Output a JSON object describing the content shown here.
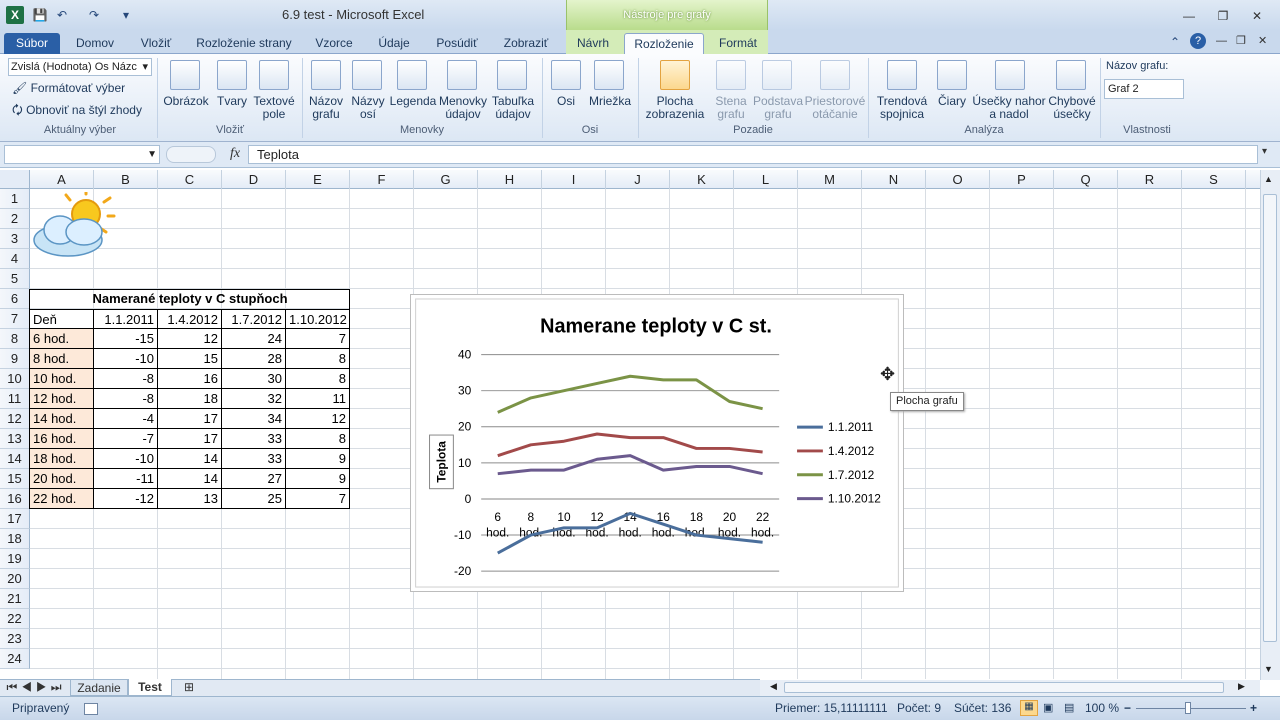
{
  "window": {
    "title": "6.9 test  -  Microsoft Excel",
    "context_tab_group": "Nástroje pre grafy"
  },
  "tabs": [
    "Súbor",
    "Domov",
    "Vložiť",
    "Rozloženie strany",
    "Vzorce",
    "Údaje",
    "Posúdiť",
    "Zobraziť",
    "Návrh",
    "Rozloženie",
    "Formát"
  ],
  "ribbon": {
    "current_selection": {
      "dropdown_value": "Zvislá (Hodnota) Os Názc",
      "format_btn": "Formátovať výber",
      "reset_btn": "Obnoviť na štýl zhody",
      "group": "Aktuálny výber"
    },
    "insert": {
      "picture": "Obrázok",
      "shapes": "Tvary",
      "textbox": "Textové pole",
      "group": "Vložiť"
    },
    "labels": {
      "chart_title": "Názov grafu",
      "axis_titles": "Názvy osí",
      "legend": "Legenda",
      "data_labels": "Menovky údajov",
      "data_table": "Tabuľka údajov",
      "group": "Menovky"
    },
    "axes": {
      "axes": "Osi",
      "gridlines": "Mriežka",
      "group": "Osi"
    },
    "background": {
      "plot_area": "Plocha zobrazenia",
      "chart_wall": "Stena grafu",
      "chart_floor": "Podstava grafu",
      "rotation": "Priestorové otáčanie",
      "group": "Pozadie"
    },
    "analysis": {
      "trendline": "Trendová spojnica",
      "lines": "Čiary",
      "updown": "Úsečky nahor a nadol",
      "errorbars": "Chybové úsečky",
      "group": "Analýza"
    },
    "properties": {
      "label": "Názov grafu:",
      "value": "Graf 2",
      "group": "Vlastnosti"
    }
  },
  "formula_bar": {
    "fx": "fx",
    "content": "Teplota"
  },
  "columns": [
    "A",
    "B",
    "C",
    "D",
    "E",
    "F",
    "G",
    "H",
    "I",
    "J",
    "K",
    "L",
    "M",
    "N",
    "O",
    "P",
    "Q",
    "R",
    "S"
  ],
  "rows": [
    "1",
    "2",
    "3",
    "4",
    "5",
    "6",
    "7",
    "8",
    "9",
    "10",
    "11",
    "12",
    "13",
    "14",
    "15",
    "16",
    "17",
    "18",
    "19",
    "20",
    "21",
    "22",
    "23",
    "24"
  ],
  "sheet": {
    "table_title": "Namerané teploty v C stupňoch",
    "header": [
      "Deň",
      "1.1.2011",
      "1.4.2012",
      "1.7.2012",
      "1.10.2012"
    ],
    "data": [
      [
        "6 hod.",
        "-15",
        "12",
        "24",
        "7"
      ],
      [
        "8 hod.",
        "-10",
        "15",
        "28",
        "8"
      ],
      [
        "10 hod.",
        "-8",
        "16",
        "30",
        "8"
      ],
      [
        "12 hod.",
        "-8",
        "18",
        "32",
        "11"
      ],
      [
        "14 hod.",
        "-4",
        "17",
        "34",
        "12"
      ],
      [
        "16 hod.",
        "-7",
        "17",
        "33",
        "8"
      ],
      [
        "18 hod.",
        "-10",
        "14",
        "33",
        "9"
      ],
      [
        "20 hod.",
        "-11",
        "14",
        "27",
        "9"
      ],
      [
        "22 hod.",
        "-12",
        "13",
        "25",
        "7"
      ]
    ]
  },
  "chart_data": {
    "type": "line",
    "title": "Namerane teploty v C st.",
    "ylabel": "Teplota",
    "ylim": [
      -20,
      40
    ],
    "yticks": [
      "-20",
      "-10",
      "0",
      "10",
      "20",
      "30",
      "40"
    ],
    "categories": [
      "6 hod.",
      "8 hod.",
      "10 hod.",
      "12 hod.",
      "14 hod.",
      "16 hod.",
      "18 hod.",
      "20 hod.",
      "22 hod."
    ],
    "series": [
      {
        "name": "1.1.2011",
        "color": "#4a6e9b",
        "values": [
          -15,
          -10,
          -8,
          -8,
          -4,
          -7,
          -10,
          -11,
          -12
        ]
      },
      {
        "name": "1.4.2012",
        "color": "#a24a4a",
        "values": [
          12,
          15,
          16,
          18,
          17,
          17,
          14,
          14,
          13
        ]
      },
      {
        "name": "1.7.2012",
        "color": "#7b9346",
        "values": [
          24,
          28,
          30,
          32,
          34,
          33,
          33,
          27,
          25
        ]
      },
      {
        "name": "1.10.2012",
        "color": "#6b5a8e",
        "values": [
          7,
          8,
          8,
          11,
          12,
          8,
          9,
          9,
          7
        ]
      }
    ],
    "legend": "right",
    "grid": true
  },
  "tooltip": "Plocha grafu",
  "sheets": [
    "Zadanie",
    "Test"
  ],
  "status": {
    "ready": "Pripravený",
    "avg": "Priemer: 15,11111111",
    "count": "Počet: 9",
    "sum": "Súčet: 136",
    "zoom": "100 %"
  }
}
